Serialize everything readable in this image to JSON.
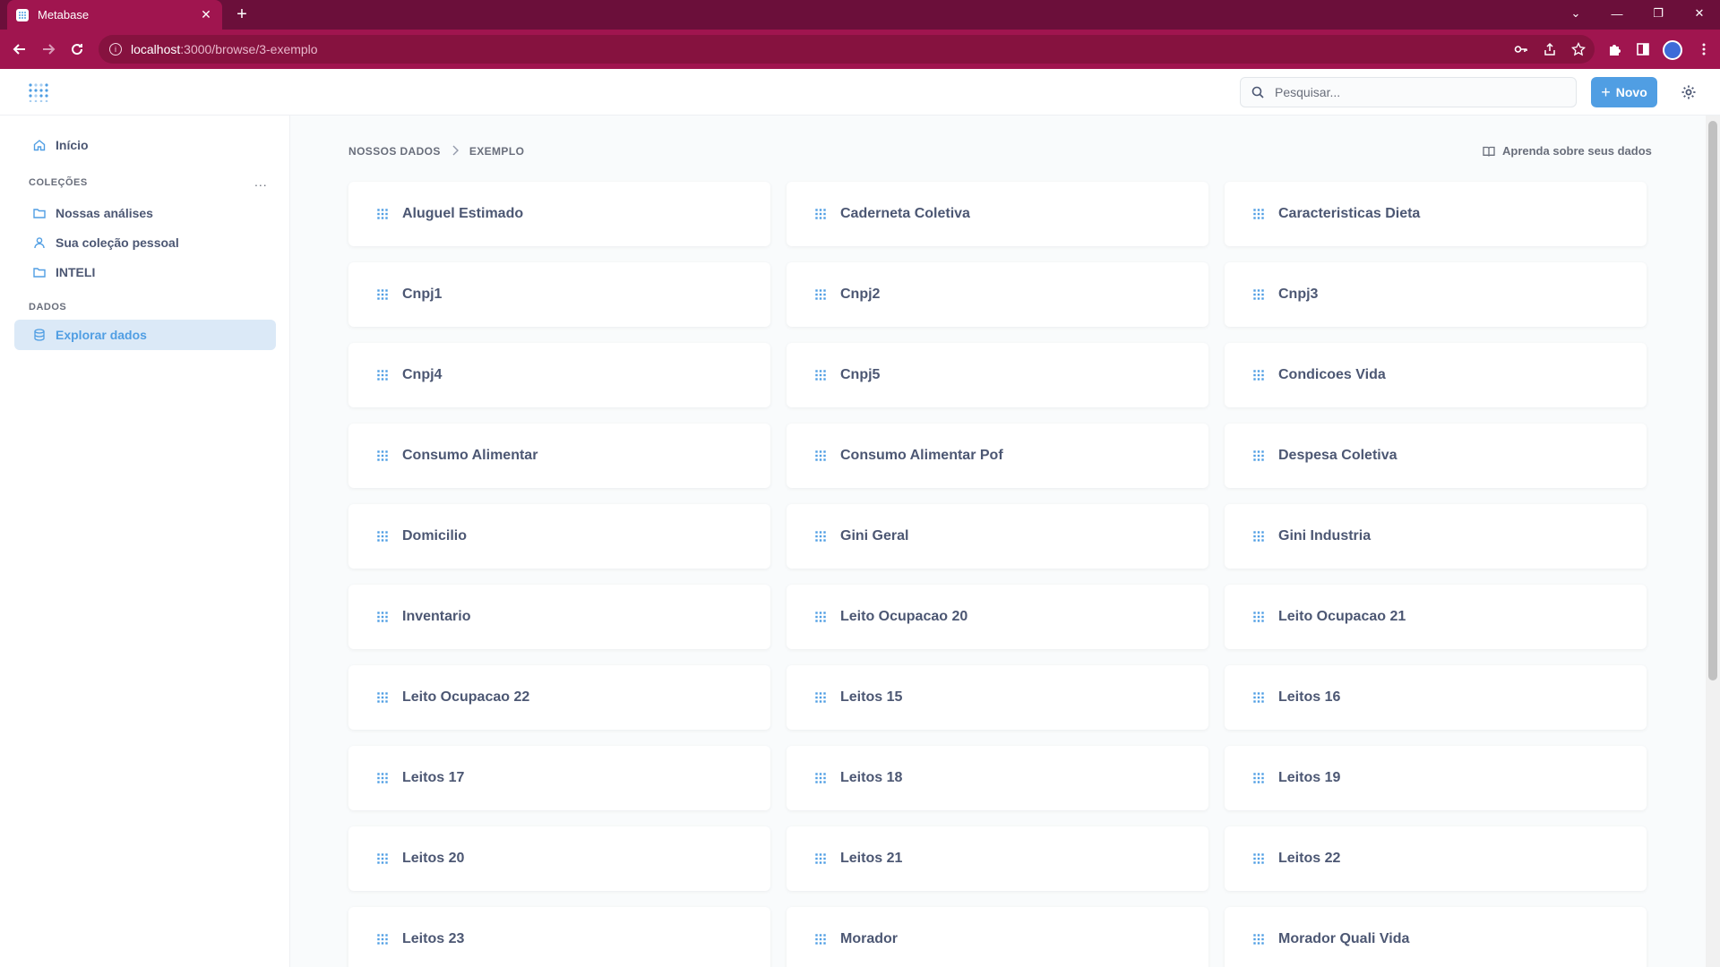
{
  "browser": {
    "tab_title": "Metabase",
    "tab_close": "✕",
    "new_tab": "+",
    "url_host": "localhost",
    "url_path": ":3000/browse/3-exemplo",
    "window_controls": [
      "⌄",
      "—",
      "❐",
      "✕"
    ]
  },
  "header": {
    "search_placeholder": "Pesquisar...",
    "new_button": "Novo"
  },
  "sidebar": {
    "home": "Início",
    "collections_heading": "COLEÇÕES",
    "collections_more": "...",
    "collections": [
      {
        "label": "Nossas análises",
        "icon": "folder-icon"
      },
      {
        "label": "Sua coleção pessoal",
        "icon": "person-icon"
      },
      {
        "label": "INTELI",
        "icon": "folder-icon"
      }
    ],
    "data_heading": "DADOS",
    "browse_data": "Explorar dados"
  },
  "breadcrumb": {
    "root": "NOSSOS DADOS",
    "current": "EXEMPLO"
  },
  "learn_link": "Aprenda sobre seus dados",
  "tables": [
    "Aluguel Estimado",
    "Caderneta Coletiva",
    "Caracteristicas Dieta",
    "Cnpj1",
    "Cnpj2",
    "Cnpj3",
    "Cnpj4",
    "Cnpj5",
    "Condicoes Vida",
    "Consumo Alimentar",
    "Consumo Alimentar Pof",
    "Despesa Coletiva",
    "Domicilio",
    "Gini Geral",
    "Gini Industria",
    "Inventario",
    "Leito Ocupacao 20",
    "Leito Ocupacao 21",
    "Leito Ocupacao 22",
    "Leitos 15",
    "Leitos 16",
    "Leitos 17",
    "Leitos 18",
    "Leitos 19",
    "Leitos 20",
    "Leitos 21",
    "Leitos 22",
    "Leitos 23",
    "Morador",
    "Morador Quali Vida"
  ],
  "colors": {
    "brand": "#509ee3",
    "browser_frame": "#6b0f3a",
    "browser_toolbar": "#a0154f"
  }
}
